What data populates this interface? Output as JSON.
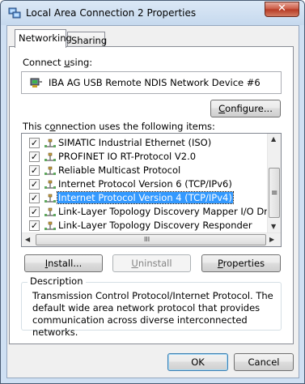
{
  "window": {
    "title": "Local Area Connection 2 Properties",
    "close_glyph": "✕"
  },
  "tabs": [
    {
      "label": "Networking"
    },
    {
      "label": "Sharing"
    }
  ],
  "connect_using": {
    "label_pre": "Connect ",
    "label_u": "u",
    "label_post": "sing:",
    "device": "IBA AG USB Remote NDIS Network Device #6"
  },
  "buttons": {
    "configure_u": "C",
    "configure_rest": "onfigure...",
    "install_u": "I",
    "install_rest": "nstall...",
    "uninstall_u": "U",
    "uninstall_rest": "ninstall",
    "properties_u": "P",
    "properties_rest": "roperties",
    "ok": "OK",
    "cancel": "Cancel"
  },
  "items_label": {
    "pre": "This c",
    "u": "o",
    "post": "nnection uses the following items:"
  },
  "items": [
    {
      "label": "SIMATIC Industrial Ethernet (ISO)",
      "checked": true
    },
    {
      "label": "PROFINET IO RT-Protocol V2.0",
      "checked": true
    },
    {
      "label": "Reliable Multicast Protocol",
      "checked": true
    },
    {
      "label": "Internet Protocol Version 6 (TCP/IPv6)",
      "checked": true
    },
    {
      "label": "Internet Protocol Version 4 (TCP/IPv4)",
      "checked": true,
      "selected": true
    },
    {
      "label": "Link-Layer Topology Discovery Mapper I/O Driver",
      "checked": true
    },
    {
      "label": "Link-Layer Topology Discovery Responder",
      "checked": true
    }
  ],
  "check_glyph": "✓",
  "scroll": {
    "left": "◀",
    "right": "▶",
    "up": "▲",
    "down": "▼",
    "grip": "III",
    "vgrip": "≡"
  },
  "description": {
    "title": "Description",
    "text": "Transmission Control Protocol/Internet Protocol. The default wide area network protocol that provides communication across diverse interconnected networks."
  },
  "colors": {
    "selection": "#3399ff",
    "title_bar": "#c6d9ee"
  }
}
